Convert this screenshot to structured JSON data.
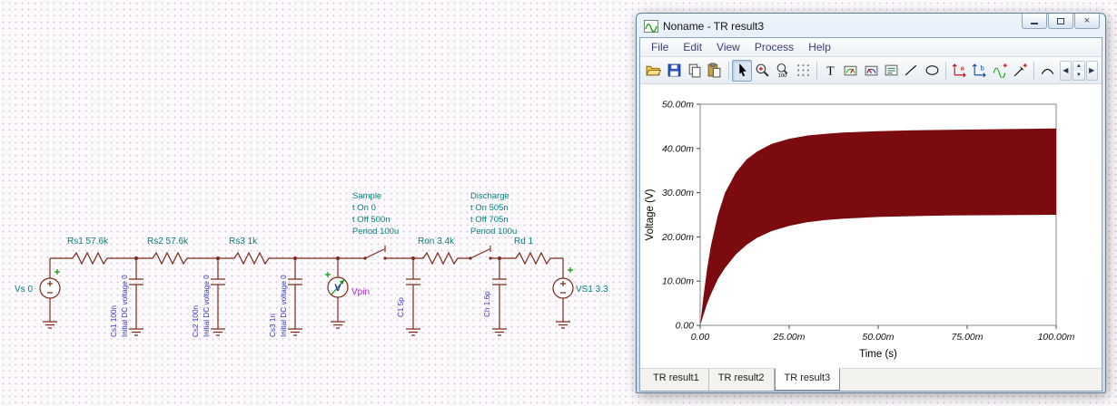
{
  "colors": {
    "wire": "#7e2a1a",
    "component_label": "#008080",
    "capacitor_label": "#3a35c0",
    "meter_label": "#a02cc0",
    "plus_mark": "#0a9a0a",
    "grid_dot": "#d9c7d9"
  },
  "schematic": {
    "sources": [
      {
        "label": "Vs 0"
      },
      {
        "label": "VS1 3.3"
      }
    ],
    "resistors": [
      {
        "label": "Rs1 57.6k"
      },
      {
        "label": "Rs2 57.6k"
      },
      {
        "label": "Rs3 1k"
      },
      {
        "label": "Ron 3.4k"
      },
      {
        "label": "Rd 1"
      }
    ],
    "capacitors": [
      {
        "label": "Cs1 100n",
        "sub": "Initial DC voltage 0"
      },
      {
        "label": "Cs2 100n",
        "sub": "Initial DC voltage 0"
      },
      {
        "label": "Cs3 1n",
        "sub": "Initial DC voltage 0"
      },
      {
        "label": "C1 5p"
      },
      {
        "label": "Ch 1.6p"
      }
    ],
    "switches": [
      {
        "name": "Sample",
        "t_on": "t On 0",
        "t_off": "t Off 500n",
        "period": "Period 100u"
      },
      {
        "name": "Discharge",
        "t_on": "t On 505n",
        "t_off": "t Off 705n",
        "period": "Period 100u"
      }
    ],
    "voltmeter": {
      "symbol": "V",
      "label": "Vpin"
    }
  },
  "window": {
    "title": "Noname - TR result3",
    "menu": [
      "File",
      "Edit",
      "View",
      "Process",
      "Help"
    ],
    "controls": {
      "close_glyph": "×"
    },
    "toolbar": {
      "zoom100_label": "100",
      "text_tool_label": "T",
      "axis_a_label": "a",
      "axis_b_label": "b",
      "nav_prev": "◀",
      "nav_next": "▶",
      "spin_up": "▲",
      "spin_down": "▼"
    },
    "tabs": [
      {
        "label": "TR result1",
        "active": false
      },
      {
        "label": "TR result2",
        "active": false
      },
      {
        "label": "TR result3",
        "active": true
      }
    ]
  },
  "chart_data": {
    "type": "area",
    "title": "",
    "xlabel": "Time (s)",
    "ylabel": "Voltage (V)",
    "x_range_ms": [
      0,
      100
    ],
    "y_range_mV": [
      0,
      50
    ],
    "grid": "off",
    "legend": "none",
    "fill_color": "#7c0b10",
    "x_ticks": [
      {
        "value_ms": 0,
        "label": "0.00"
      },
      {
        "value_ms": 25,
        "label": "25.00m"
      },
      {
        "value_ms": 50,
        "label": "50.00m"
      },
      {
        "value_ms": 75,
        "label": "75.00m"
      },
      {
        "value_ms": 100,
        "label": "100.00m"
      }
    ],
    "y_ticks": [
      {
        "value_mV": 0,
        "label": "0.00"
      },
      {
        "value_mV": 10,
        "label": "10.00m"
      },
      {
        "value_mV": 20,
        "label": "20.00m"
      },
      {
        "value_mV": 30,
        "label": "30.00m"
      },
      {
        "value_mV": 40,
        "label": "40.00m"
      },
      {
        "value_mV": 50,
        "label": "50.00m"
      }
    ],
    "series": [
      {
        "name": "upper envelope",
        "x_ms": [
          0,
          1,
          2,
          3,
          5,
          7,
          10,
          13,
          16,
          20,
          25,
          30,
          35,
          40,
          50,
          60,
          70,
          80,
          90,
          100
        ],
        "values_mV": [
          0,
          7,
          13,
          18,
          25,
          30,
          34.5,
          37.5,
          39.3,
          41,
          42.2,
          42.9,
          43.3,
          43.6,
          43.9,
          44.1,
          44.2,
          44.3,
          44.4,
          44.5
        ]
      },
      {
        "name": "lower envelope",
        "x_ms": [
          0,
          1,
          2,
          3,
          5,
          7,
          10,
          13,
          16,
          20,
          25,
          30,
          35,
          40,
          50,
          60,
          70,
          80,
          90,
          100
        ],
        "values_mV": [
          0,
          2.5,
          5,
          7,
          10.5,
          13,
          16,
          18.2,
          19.8,
          21.3,
          22.5,
          23.3,
          23.8,
          24.1,
          24.5,
          24.7,
          24.85,
          24.9,
          24.95,
          25
        ]
      }
    ]
  }
}
